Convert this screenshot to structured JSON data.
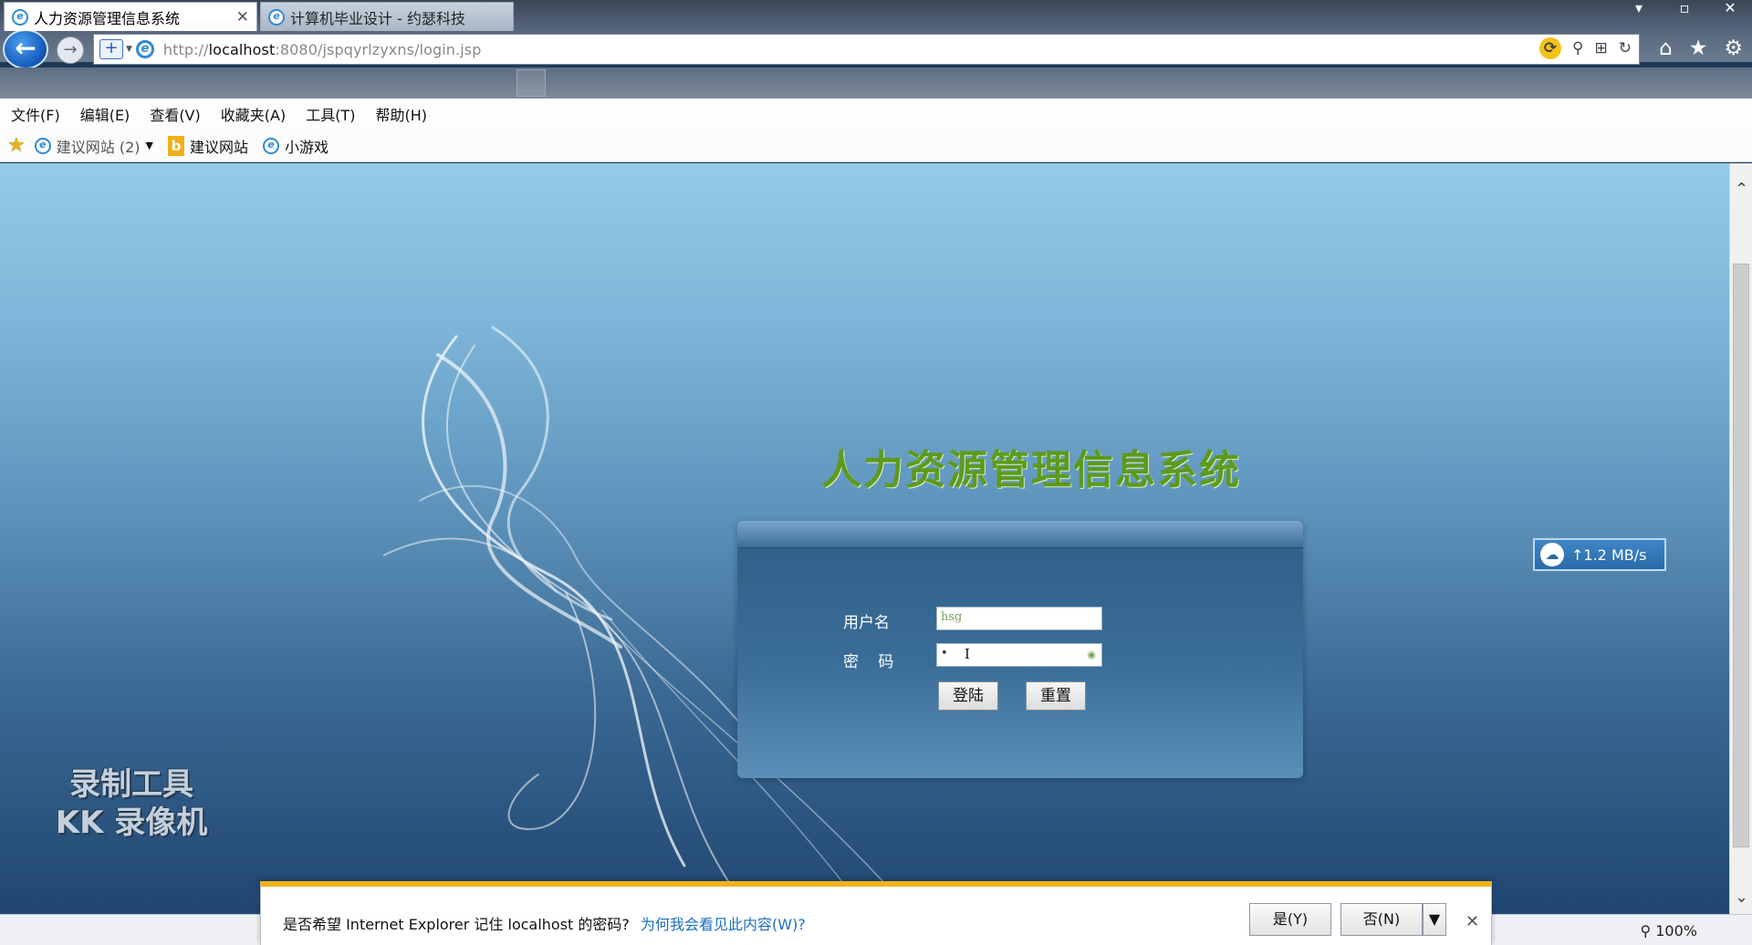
{
  "window": {
    "controls": [
      "▾",
      "▫",
      "✕"
    ]
  },
  "address": {
    "url_prefix": "http://",
    "url_host": "localhost",
    "url_rest": ":8080/jspqyrlzyxns/login.jsp"
  },
  "tabs": [
    {
      "label": "人力资源管理信息系统",
      "active": true
    },
    {
      "label": "计算机毕业设计 - 约瑟科技",
      "active": false
    }
  ],
  "menu": [
    "文件(F)",
    "编辑(E)",
    "查看(V)",
    "收藏夹(A)",
    "工具(T)",
    "帮助(H)"
  ],
  "favorites": {
    "items": [
      {
        "label": "建议网站 (2)",
        "icon": "ie-icon",
        "dropdown": true
      },
      {
        "label": "建议网站",
        "icon": "bing-icon"
      },
      {
        "label": "小游戏",
        "icon": "ie-icon"
      }
    ]
  },
  "page": {
    "title": "人力资源管理信息系统",
    "form": {
      "username_label": "用户名",
      "password_label": "密 码",
      "username_value": "hsg",
      "password_value": "•",
      "login_button": "登陆",
      "reset_button": "重置"
    },
    "watermark": [
      "录制工具",
      "KK 录像机"
    ],
    "speed_widget": "↑1.2 MB/s"
  },
  "notification": {
    "message": "是否希望 Internet Explorer 记住 localhost 的密码?",
    "link": "为何我会看见此内容(W)?",
    "yes": "是(Y)",
    "no": "否(N)"
  },
  "status": {
    "zoom": "100%"
  },
  "colors": {
    "title_green": "#5d9a1c",
    "panel_blue": "#3a6d98",
    "notify_accent": "#f2b21a"
  }
}
